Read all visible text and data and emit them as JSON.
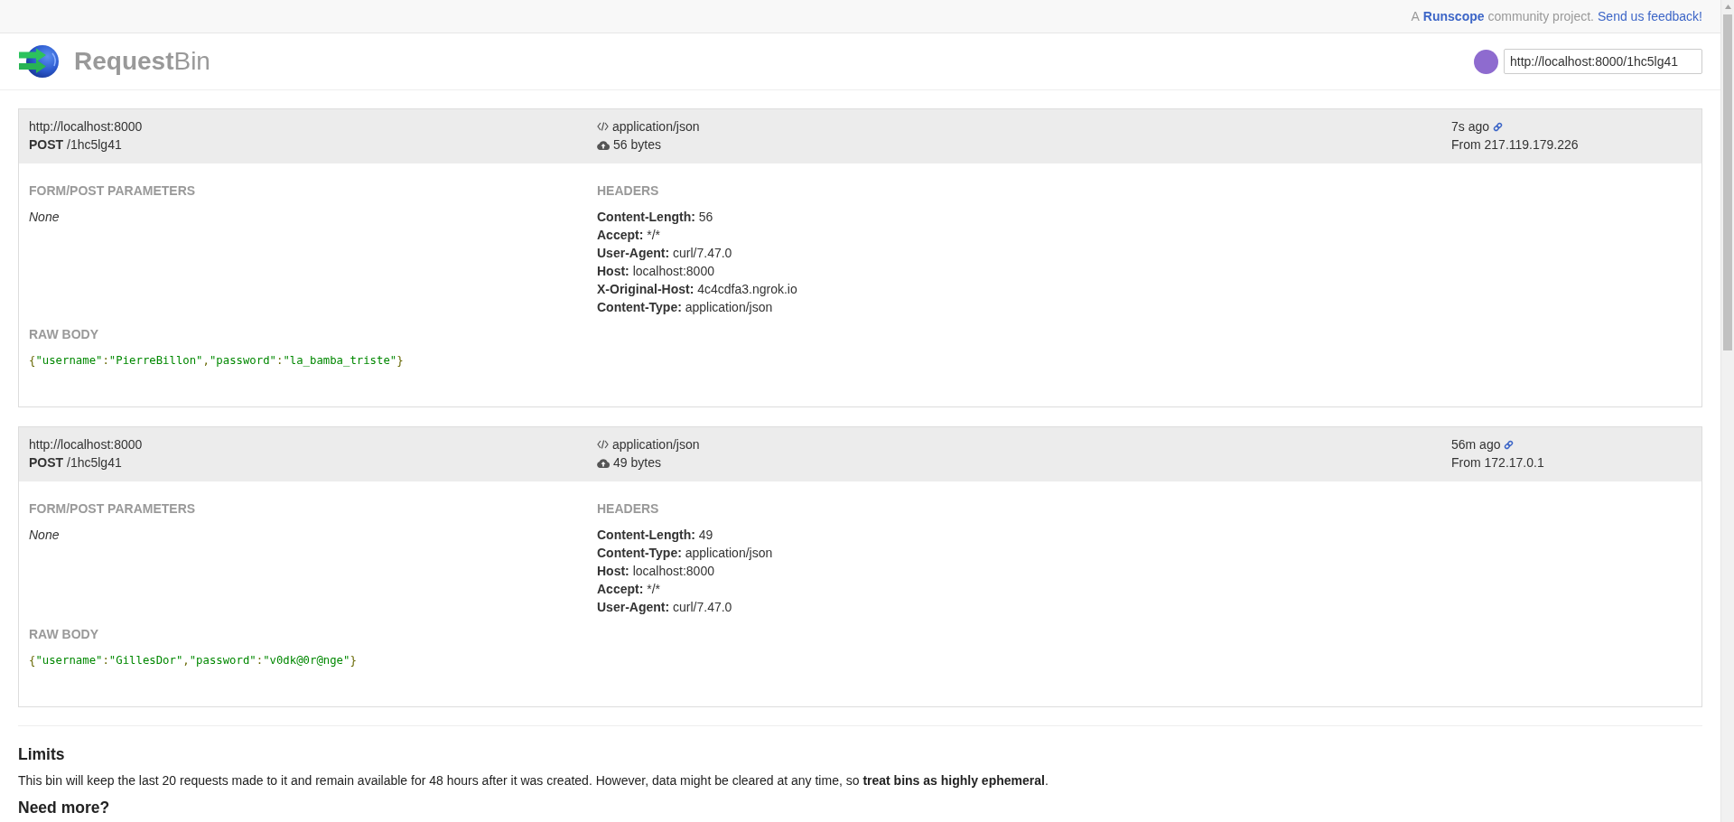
{
  "top_bar": {
    "prefix": "A",
    "project_link": "Runscope",
    "suffix": "community project.",
    "feedback_link": "Send us feedback!"
  },
  "header": {
    "title": "**Request**Bin",
    "bin_url": "http://localhost:8000/1hc5lg41"
  },
  "requests": [
    {
      "base_url": "http://localhost:8000",
      "method": "POST",
      "path": "/1hc5lg41",
      "content_type": "application/json",
      "size": "56 bytes",
      "age": "7s ago",
      "source": "From 217.119.179.226",
      "form_title": "FORM/POST PARAMETERS",
      "form_value": "None",
      "headers_title": "HEADERS",
      "headers": [
        {
          "name": "Content-Length:",
          "value": "56"
        },
        {
          "name": "Accept:",
          "value": "*/*"
        },
        {
          "name": "User-Agent:",
          "value": "curl/7.47.0"
        },
        {
          "name": "Host:",
          "value": "localhost:8000"
        },
        {
          "name": "X-Original-Host:",
          "value": "4c4cdfa3.ngrok.io"
        },
        {
          "name": "Content-Type:",
          "value": "application/json"
        }
      ],
      "raw_body_title": "RAW BODY",
      "raw_body": "{\"username\":\"PierreBillon\",\"password\":\"la_bamba_triste\"}"
    },
    {
      "base_url": "http://localhost:8000",
      "method": "POST",
      "path": "/1hc5lg41",
      "content_type": "application/json",
      "size": "49 bytes",
      "age": "56m ago",
      "source": "From 172.17.0.1",
      "form_title": "FORM/POST PARAMETERS",
      "form_value": "None",
      "headers_title": "HEADERS",
      "headers": [
        {
          "name": "Content-Length:",
          "value": "49"
        },
        {
          "name": "Content-Type:",
          "value": "application/json"
        },
        {
          "name": "Host:",
          "value": "localhost:8000"
        },
        {
          "name": "Accept:",
          "value": "*/*"
        },
        {
          "name": "User-Agent:",
          "value": "curl/7.47.0"
        }
      ],
      "raw_body_title": "RAW BODY",
      "raw_body": "{\"username\":\"GillesDor\",\"password\":\"v0dk@0r@nge\"}"
    }
  ],
  "limits": {
    "title": "Limits",
    "text": "This bin will keep the last 20 requests made to it and remain available for 48 hours after it was created. However, data might be cleared at any time, so **treat bins as highly ephemeral**."
  },
  "need_more": {
    "title": "Need more?"
  }
}
